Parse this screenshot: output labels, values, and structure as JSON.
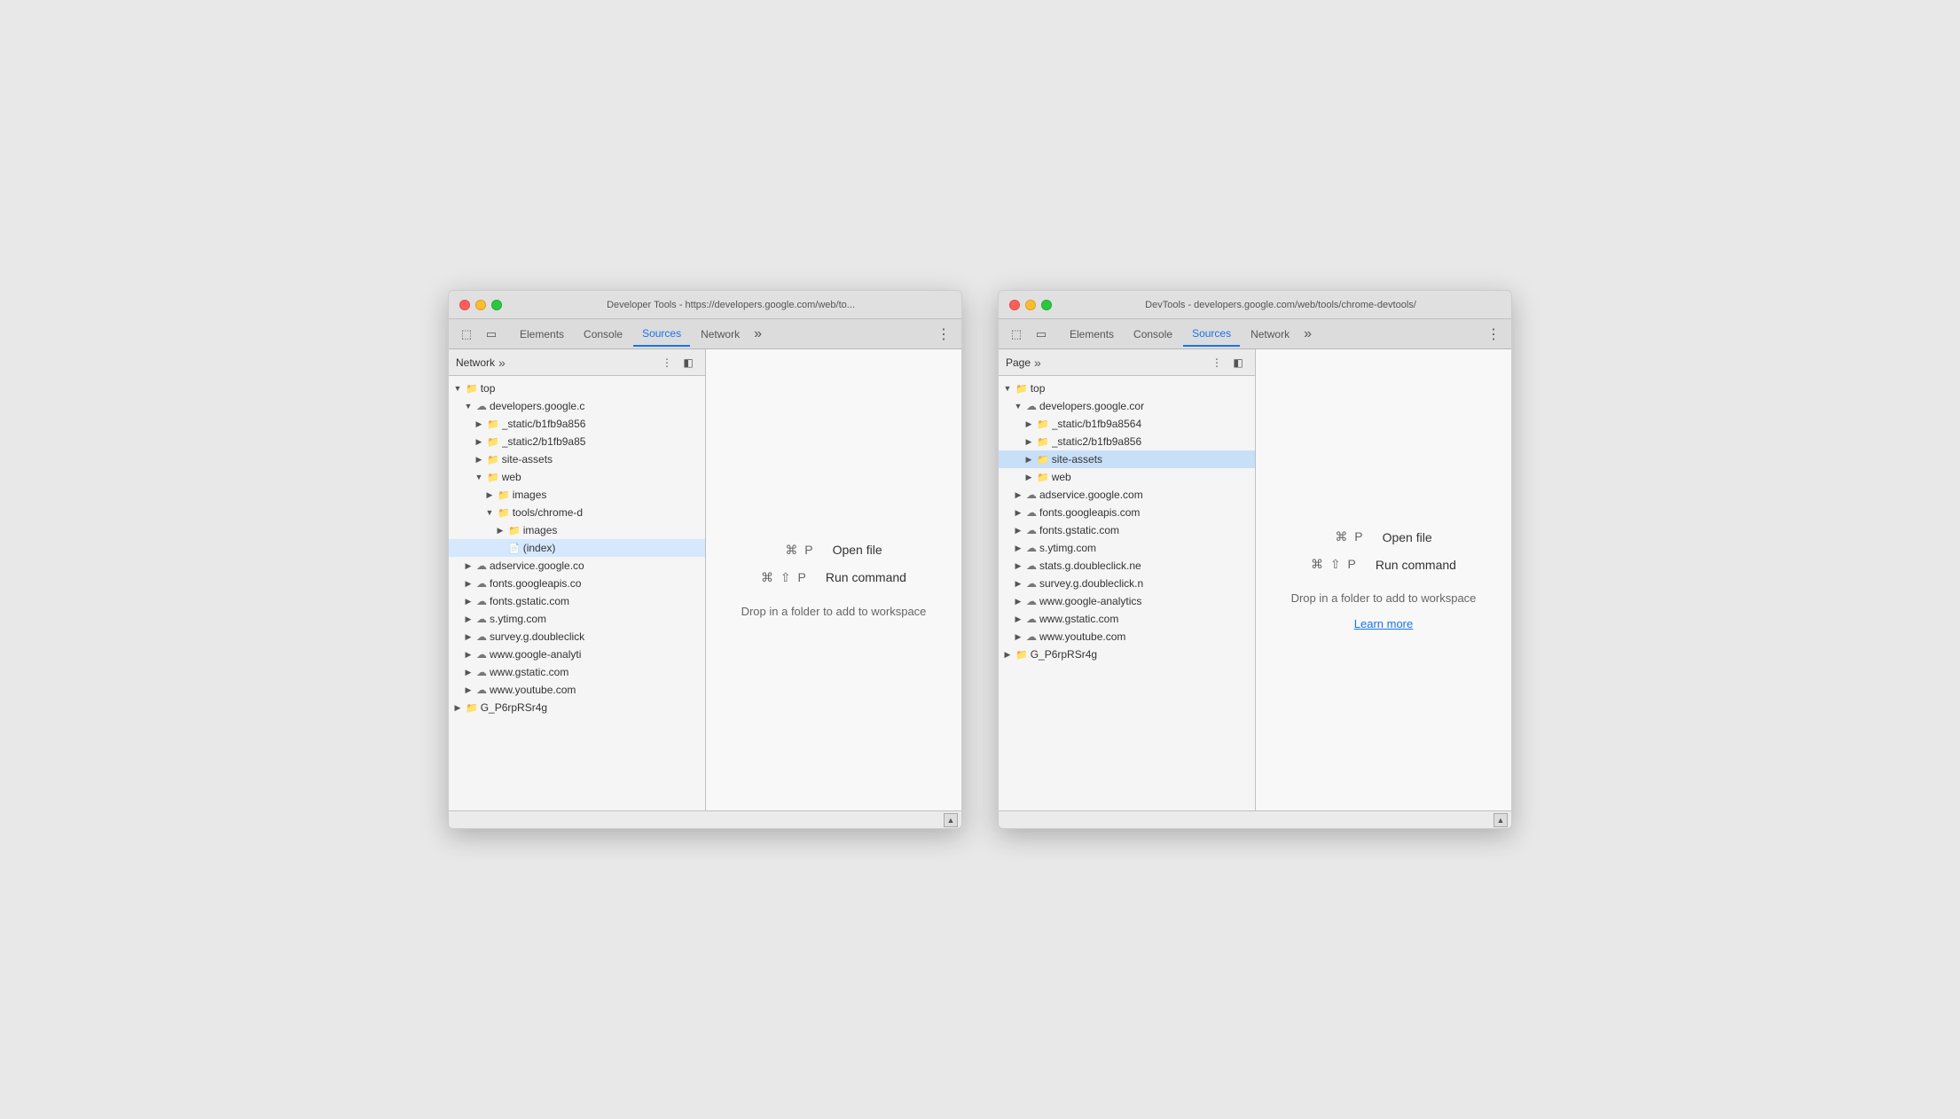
{
  "window1": {
    "title": "Developer Tools - https://developers.google.com/web/to...",
    "tabs": [
      "Elements",
      "Console",
      "Sources",
      "Network"
    ],
    "active_tab": "Sources",
    "sidebar": {
      "label": "Network",
      "panel_icon": "◧",
      "toggle_icon": "⊡"
    },
    "tree": [
      {
        "id": "top",
        "label": "top",
        "indent": 0,
        "arrow": "open",
        "icon": "folder-empty"
      },
      {
        "id": "developers",
        "label": "developers.google.c",
        "indent": 1,
        "arrow": "open",
        "icon": "cloud"
      },
      {
        "id": "static1",
        "label": "_static/b1fb9a856",
        "indent": 2,
        "arrow": "closed",
        "icon": "folder"
      },
      {
        "id": "static2",
        "label": "_static2/b1fb9a85",
        "indent": 2,
        "arrow": "closed",
        "icon": "folder"
      },
      {
        "id": "site-assets",
        "label": "site-assets",
        "indent": 2,
        "arrow": "closed",
        "icon": "folder"
      },
      {
        "id": "web",
        "label": "web",
        "indent": 2,
        "arrow": "open",
        "icon": "folder"
      },
      {
        "id": "images",
        "label": "images",
        "indent": 3,
        "arrow": "closed",
        "icon": "folder"
      },
      {
        "id": "tools",
        "label": "tools/chrome-d",
        "indent": 3,
        "arrow": "open",
        "icon": "folder"
      },
      {
        "id": "images2",
        "label": "images",
        "indent": 4,
        "arrow": "closed",
        "icon": "folder"
      },
      {
        "id": "index",
        "label": "(index)",
        "indent": 4,
        "arrow": "none",
        "icon": "file",
        "selected": true
      },
      {
        "id": "adservice",
        "label": "adservice.google.co",
        "indent": 1,
        "arrow": "closed",
        "icon": "cloud"
      },
      {
        "id": "googleapis",
        "label": "fonts.googleapis.co",
        "indent": 1,
        "arrow": "closed",
        "icon": "cloud"
      },
      {
        "id": "gstatic",
        "label": "fonts.gstatic.com",
        "indent": 1,
        "arrow": "closed",
        "icon": "cloud"
      },
      {
        "id": "ytimg",
        "label": "s.ytimg.com",
        "indent": 1,
        "arrow": "closed",
        "icon": "cloud"
      },
      {
        "id": "doubleclick",
        "label": "survey.g.doubleclick",
        "indent": 1,
        "arrow": "closed",
        "icon": "cloud"
      },
      {
        "id": "analytics",
        "label": "www.google-analyti",
        "indent": 1,
        "arrow": "closed",
        "icon": "cloud"
      },
      {
        "id": "gstatic2",
        "label": "www.gstatic.com",
        "indent": 1,
        "arrow": "closed",
        "icon": "cloud"
      },
      {
        "id": "youtube",
        "label": "www.youtube.com",
        "indent": 1,
        "arrow": "closed",
        "icon": "cloud"
      },
      {
        "id": "g_p6",
        "label": "G_P6rpRSr4g",
        "indent": 0,
        "arrow": "closed",
        "icon": "folder-empty"
      }
    ],
    "panel": {
      "cmd1_key": "⌘ P",
      "cmd1_label": "Open file",
      "cmd2_key": "⌘ ⇧ P",
      "cmd2_label": "Run command",
      "drop_text": "Drop in a folder to add to workspace"
    }
  },
  "window2": {
    "title": "DevTools - developers.google.com/web/tools/chrome-devtools/",
    "tabs": [
      "Elements",
      "Console",
      "Sources",
      "Network"
    ],
    "active_tab": "Sources",
    "sidebar": {
      "label": "Page",
      "panel_icon": "◧",
      "toggle_icon": "⊡"
    },
    "tree": [
      {
        "id": "top",
        "label": "top",
        "indent": 0,
        "arrow": "open",
        "icon": "folder-empty"
      },
      {
        "id": "developers",
        "label": "developers.google.cor",
        "indent": 1,
        "arrow": "open",
        "icon": "cloud"
      },
      {
        "id": "static1",
        "label": "_static/b1fb9a8564",
        "indent": 2,
        "arrow": "closed",
        "icon": "folder"
      },
      {
        "id": "static2",
        "label": "_static2/b1fb9a856",
        "indent": 2,
        "arrow": "closed",
        "icon": "folder"
      },
      {
        "id": "site-assets",
        "label": "site-assets",
        "indent": 2,
        "arrow": "closed",
        "icon": "folder",
        "highlighted": true
      },
      {
        "id": "web",
        "label": "web",
        "indent": 2,
        "arrow": "closed",
        "icon": "folder"
      },
      {
        "id": "adservice",
        "label": "adservice.google.com",
        "indent": 1,
        "arrow": "closed",
        "icon": "cloud"
      },
      {
        "id": "googleapis",
        "label": "fonts.googleapis.com",
        "indent": 1,
        "arrow": "closed",
        "icon": "cloud"
      },
      {
        "id": "gstatic",
        "label": "fonts.gstatic.com",
        "indent": 1,
        "arrow": "closed",
        "icon": "cloud"
      },
      {
        "id": "ytimg",
        "label": "s.ytimg.com",
        "indent": 1,
        "arrow": "closed",
        "icon": "cloud"
      },
      {
        "id": "doubleclick1",
        "label": "stats.g.doubleclick.ne",
        "indent": 1,
        "arrow": "closed",
        "icon": "cloud"
      },
      {
        "id": "doubleclick2",
        "label": "survey.g.doubleclick.n",
        "indent": 1,
        "arrow": "closed",
        "icon": "cloud"
      },
      {
        "id": "analytics",
        "label": "www.google-analytics",
        "indent": 1,
        "arrow": "closed",
        "icon": "cloud"
      },
      {
        "id": "gstatic2",
        "label": "www.gstatic.com",
        "indent": 1,
        "arrow": "closed",
        "icon": "cloud"
      },
      {
        "id": "youtube",
        "label": "www.youtube.com",
        "indent": 1,
        "arrow": "closed",
        "icon": "cloud"
      },
      {
        "id": "g_p6",
        "label": "G_P6rpRSr4g",
        "indent": 0,
        "arrow": "closed",
        "icon": "folder-empty"
      }
    ],
    "panel": {
      "cmd1_key": "⌘ P",
      "cmd1_label": "Open file",
      "cmd2_key": "⌘ ⇧ P",
      "cmd2_label": "Run command",
      "drop_text": "Drop in a folder to add to workspace",
      "learn_more": "Learn more"
    }
  }
}
